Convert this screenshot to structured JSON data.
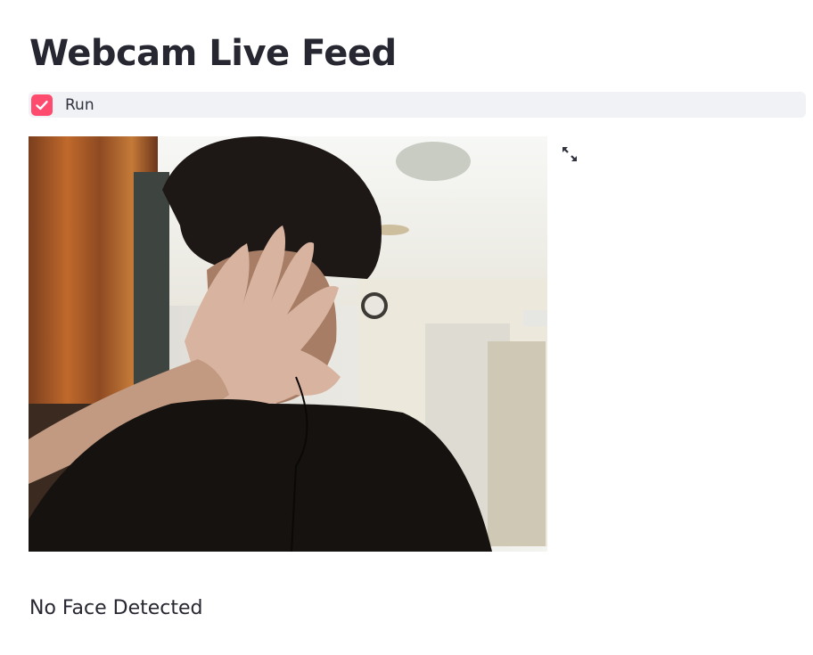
{
  "page": {
    "title": "Webcam Live Feed"
  },
  "controls": {
    "run_checkbox": {
      "label": "Run",
      "checked": true
    },
    "fullscreen_icon": "expand-icon"
  },
  "feed": {
    "icon": "webcam-image"
  },
  "status": {
    "text": "No Face Detected"
  },
  "colors": {
    "accent": "#ff4b6e",
    "checkbox_row_bg": "#f0f2f6",
    "text": "#262730"
  }
}
